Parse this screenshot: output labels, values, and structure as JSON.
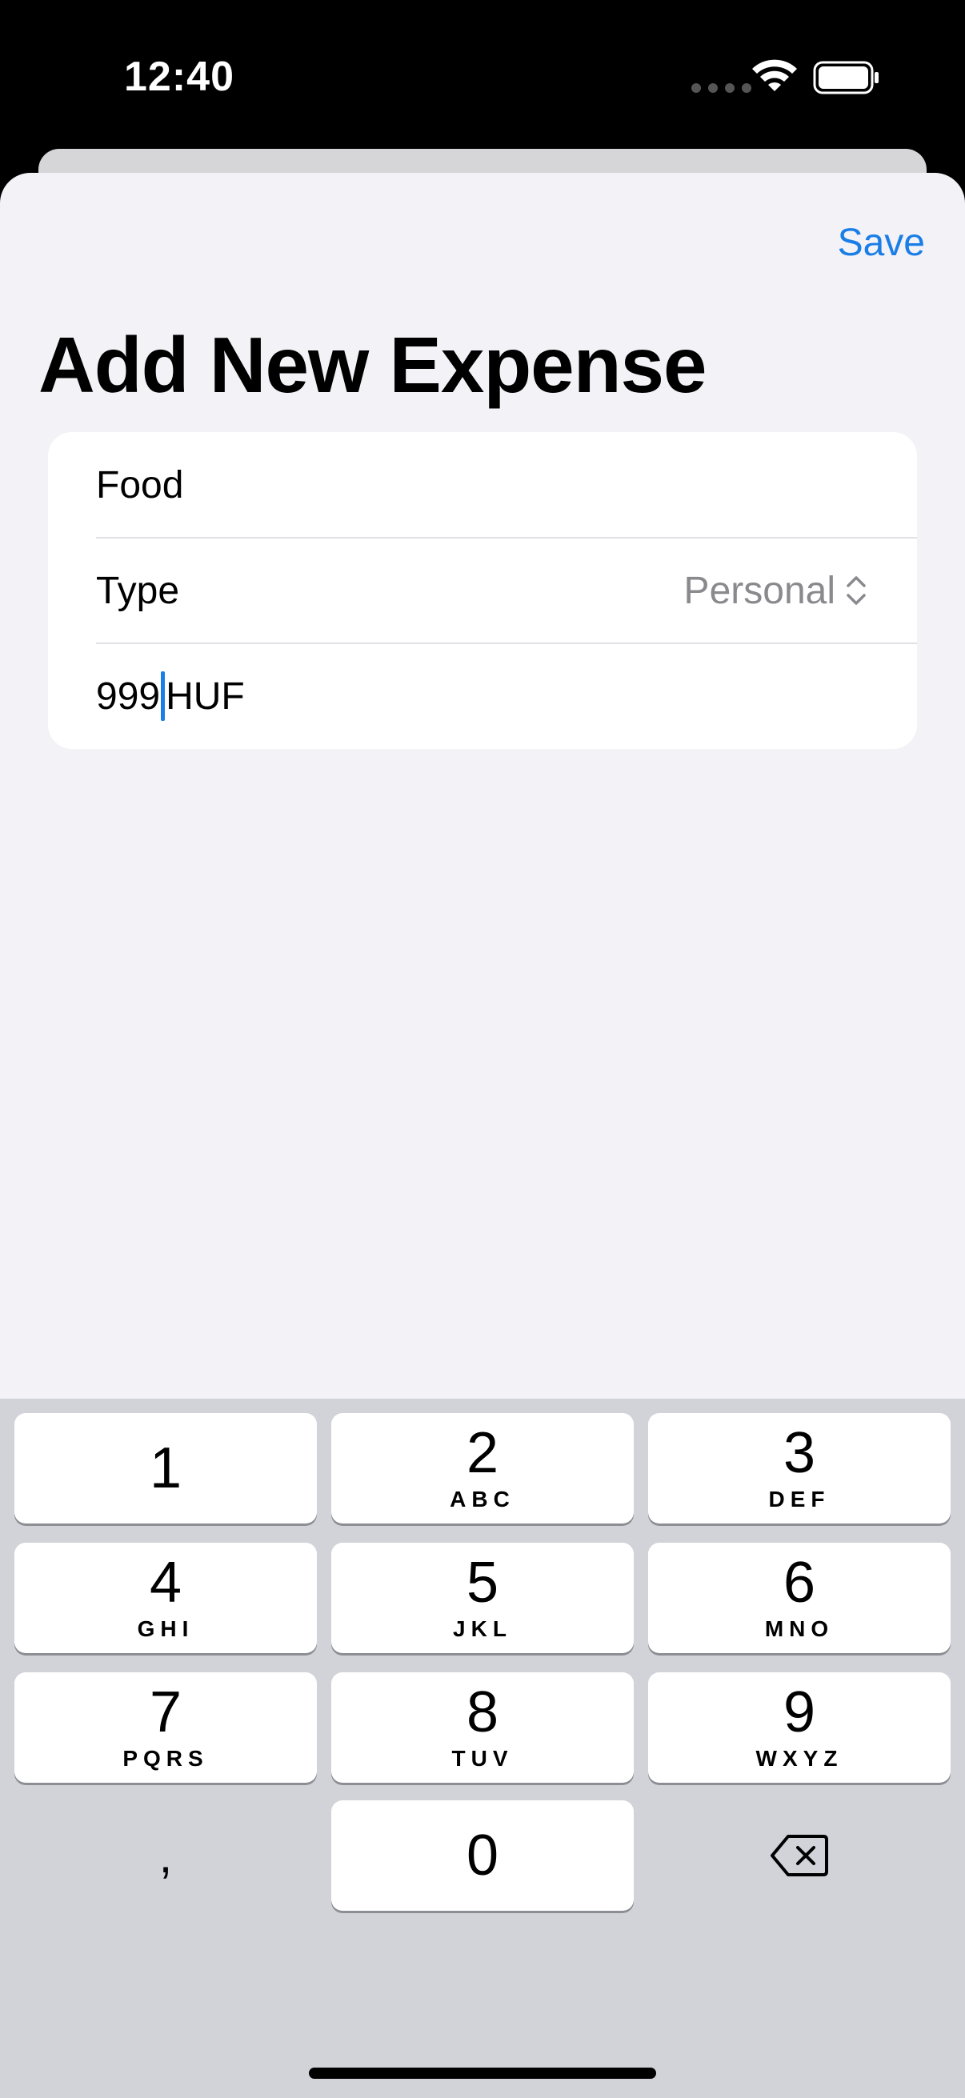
{
  "status_bar": {
    "time": "12:40",
    "icons": [
      "signal-dots-icon",
      "wifi-icon",
      "battery-icon"
    ]
  },
  "toolbar": {
    "save_label": "Save"
  },
  "page": {
    "title": "Add New Expense"
  },
  "form": {
    "name_value": "Food",
    "type_label": "Type",
    "type_value": "Personal",
    "amount_value": "999",
    "currency": "HUF"
  },
  "keyboard": {
    "keys": [
      {
        "num": "1",
        "letters": ""
      },
      {
        "num": "2",
        "letters": "ABC"
      },
      {
        "num": "3",
        "letters": "DEF"
      },
      {
        "num": "4",
        "letters": "GHI"
      },
      {
        "num": "5",
        "letters": "JKL"
      },
      {
        "num": "6",
        "letters": "MNO"
      },
      {
        "num": "7",
        "letters": "PQRS"
      },
      {
        "num": "8",
        "letters": "TUV"
      },
      {
        "num": "9",
        "letters": "WXYZ"
      },
      {
        "num": "0",
        "letters": ""
      }
    ],
    "comma": ",",
    "delete_icon": "delete-backspace-icon"
  },
  "colors": {
    "accent": "#1a7ee6",
    "background": "#f2f2f7",
    "keyboard_bg": "#d1d3d9"
  }
}
